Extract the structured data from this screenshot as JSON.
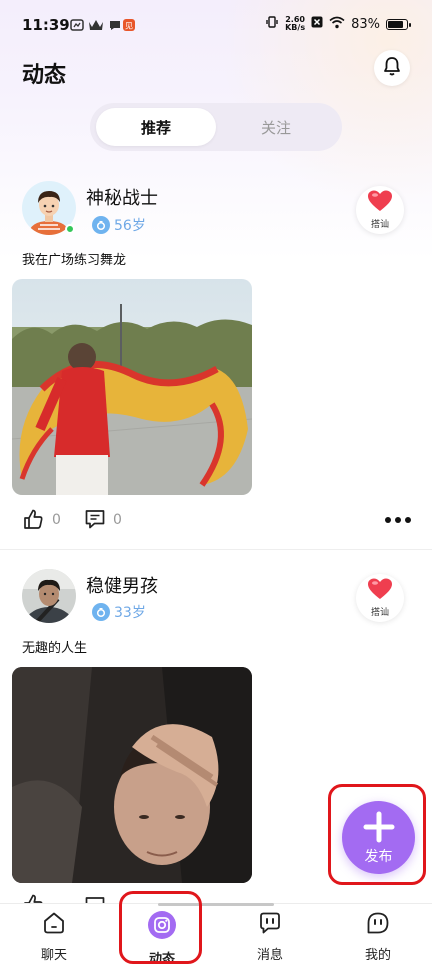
{
  "status_bar": {
    "time": "11:39",
    "net_speed_value": "2.60",
    "net_speed_unit": "KB/s",
    "battery": "83%"
  },
  "header": {
    "title": "动态",
    "bell_icon": "bell-icon"
  },
  "tabs": [
    {
      "label": "推荐",
      "active": true
    },
    {
      "label": "关注",
      "active": false
    }
  ],
  "posts": [
    {
      "username": "神秘战士",
      "age": "56岁",
      "online": true,
      "greet_label": "搭讪",
      "text": "我在广场练习舞龙",
      "likes": "0",
      "comments": "0"
    },
    {
      "username": "稳健男孩",
      "age": "33岁",
      "online": false,
      "greet_label": "搭讪",
      "text": "无趣的人生",
      "likes": "",
      "comments": ""
    }
  ],
  "fab": {
    "label": "发布",
    "color": "#a36bf2"
  },
  "bottom_nav": [
    {
      "label": "聊天",
      "icon": "chat-home-icon"
    },
    {
      "label": "动态",
      "icon": "moments-camera-icon",
      "active": true
    },
    {
      "label": "消息",
      "icon": "message-icon"
    },
    {
      "label": "我的",
      "icon": "profile-face-icon"
    }
  ],
  "colors": {
    "accent": "#a36bf2",
    "highlight": "#e0161b",
    "age_blue": "#6fa8e6"
  }
}
